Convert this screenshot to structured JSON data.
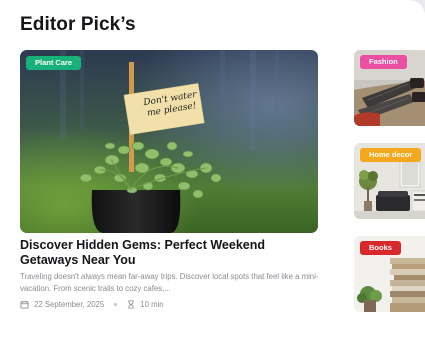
{
  "section": {
    "title": "Editor Pick’s"
  },
  "featured": {
    "category": "Plant Care",
    "note_line1": "Don't water",
    "note_line2": "me please!",
    "headline": "Discover Hidden Gems: Perfect Weekend Getaways Near You",
    "excerpt": "Traveling doesn't always mean far-away trips. Discover local spots that feel like a mini-vacation. From scenic trails to cozy cafes,...",
    "date": "22 September, 2025",
    "read_time": "10 min",
    "colors": {
      "badge": "#17b179"
    }
  },
  "side_cards": [
    {
      "category": "Fashion",
      "badge_color": "#ec4fa2"
    },
    {
      "category": "Home decor",
      "badge_color": "#f3a81d"
    },
    {
      "category": "Books",
      "badge_color": "#d9282c"
    }
  ],
  "icons": {
    "date": "calendar-icon",
    "read_time": "hourglass-icon"
  }
}
